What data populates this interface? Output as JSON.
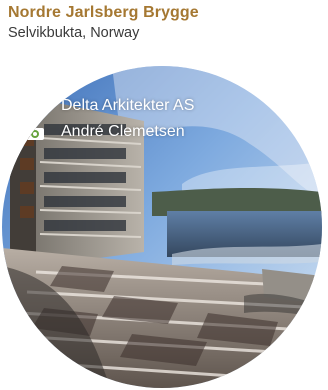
{
  "project": {
    "title": "Nordre Jarlsberg Brygge",
    "location": "Selvikbukta, Norway"
  },
  "credits": {
    "architect": {
      "icon": "pencil-icon",
      "text": "Delta Arkitekter AS"
    },
    "photographer": {
      "icon": "camera-icon",
      "text": "André Clemetsen"
    }
  },
  "colors": {
    "title": "#a57832",
    "subtitle": "#3a3a3a",
    "overlay_text": "#ffffff"
  }
}
